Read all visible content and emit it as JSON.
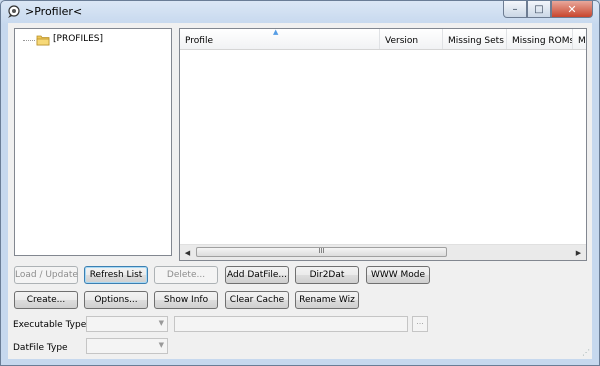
{
  "window": {
    "title": ">Profiler<"
  },
  "tree": {
    "root_label": "[PROFILES]"
  },
  "list": {
    "columns": [
      "Profile",
      "Version",
      "Missing Sets",
      "Missing ROMs",
      "Mi"
    ],
    "scroll_grip": "III"
  },
  "buttons_row1": [
    "Load / Update",
    "Refresh List",
    "Delete...",
    "Add DatFile...",
    "Dir2Dat",
    "WWW Mode"
  ],
  "buttons_row2": [
    "Create...",
    "Options...",
    "Show Info",
    "Clear Cache",
    "Rename Wiz"
  ],
  "executable_type": {
    "label": "Executable Type",
    "value": "",
    "path": "",
    "browse_label": "..."
  },
  "datfile_type": {
    "label": "DatFile Type",
    "value": ""
  }
}
